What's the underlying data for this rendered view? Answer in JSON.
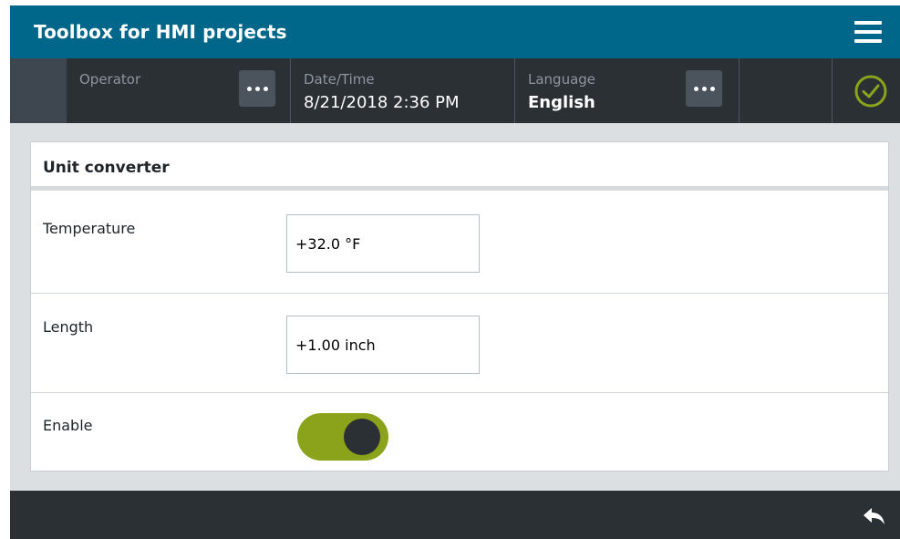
{
  "app": {
    "title": "Toolbox for HMI projects",
    "menu_icon": "hamburger-menu-icon"
  },
  "status": {
    "operator": {
      "label": "Operator",
      "value": "",
      "button_icon": "more-dots-icon"
    },
    "datetime": {
      "label": "Date/Time",
      "value": "8/21/2018 2:36 PM"
    },
    "language": {
      "label": "Language",
      "value": "English",
      "button_icon": "more-dots-icon"
    },
    "status_icon": "check-circle-icon"
  },
  "panel": {
    "title": "Unit converter",
    "temperature": {
      "label": "Temperature",
      "value": "+32.0 °F"
    },
    "length": {
      "label": "Length",
      "value": "+1.00 inch"
    },
    "enable": {
      "label": "Enable",
      "state": "on"
    }
  },
  "footer": {
    "back_icon": "back-arrow-icon"
  },
  "colors": {
    "titlebar": "#00678a",
    "statusbar": "#2b3035",
    "toggle_on": "#8aa31a",
    "check": "#8aa31a"
  }
}
